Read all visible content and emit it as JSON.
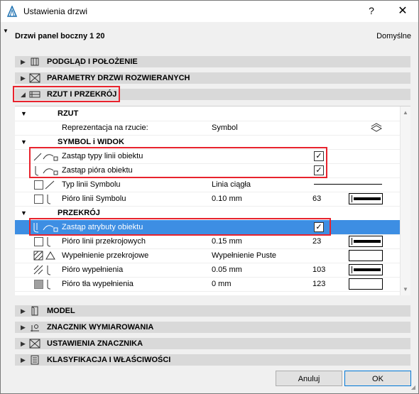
{
  "window": {
    "title": "Ustawienia drzwi",
    "help_label": "?",
    "close_label": "✕"
  },
  "header": {
    "object_name": "Drzwi panel boczny 1 20",
    "default_label": "Domyślne"
  },
  "sections_top": [
    {
      "label": "PODGLĄD I POŁOŻENIE",
      "expanded": false,
      "icon": "preview-icon"
    },
    {
      "label": "PARAMETRY DRZWI ROZWIERANYCH",
      "expanded": false,
      "icon": "parameters-icon"
    },
    {
      "label": "RZUT I PRZEKRÓJ",
      "expanded": true,
      "icon": "floorplan-section-icon"
    }
  ],
  "panel": {
    "group_rzut": "RZUT",
    "rep_label": "Reprezentacja na rzucie:",
    "rep_value": "Symbol",
    "group_symbol": "SYMBOL i WIDOK",
    "override_line_types": "Zastąp typy linii obiektu",
    "override_pens": "Zastąp pióra obiektu",
    "symbol_line_type_label": "Typ linii Symbolu",
    "symbol_line_type_value": "Linia ciągła",
    "symbol_pen_label": "Pióro linii Symbolu",
    "symbol_pen_value": "0.10 mm",
    "symbol_pen_num": "63",
    "group_section": "PRZEKRÓJ",
    "override_attrs": "Zastąp atrybuty obiektu",
    "cut_pen_label": "Pióro linii przekrojowych",
    "cut_pen_value": "0.15 mm",
    "cut_pen_num": "23",
    "cut_fill_label": "Wypełnienie przekrojowe",
    "cut_fill_value": "Wypełnienie Puste",
    "fill_pen_label": "Pióro wypełnienia",
    "fill_pen_value": "0.05 mm",
    "fill_pen_num": "103",
    "bg_pen_label": "Pióro tła wypełnienia",
    "bg_pen_value": "0 mm",
    "bg_pen_num": "123",
    "check_mark": "✓"
  },
  "sections_bottom": [
    {
      "label": "MODEL",
      "icon": "model-icon"
    },
    {
      "label": "ZNACZNIK WYMIAROWANIA",
      "icon": "dimension-marker-icon"
    },
    {
      "label": "USTAWIENIA ZNACZNIKA",
      "icon": "marker-settings-icon"
    },
    {
      "label": "KLASYFIKACJA I WŁAŚCIWOŚCI",
      "icon": "classification-icon"
    }
  ],
  "buttons": {
    "cancel": "Anuluj",
    "ok": "OK"
  },
  "colors": {
    "highlight_border": "#e8232d",
    "selected_row": "#3d8ee3"
  }
}
